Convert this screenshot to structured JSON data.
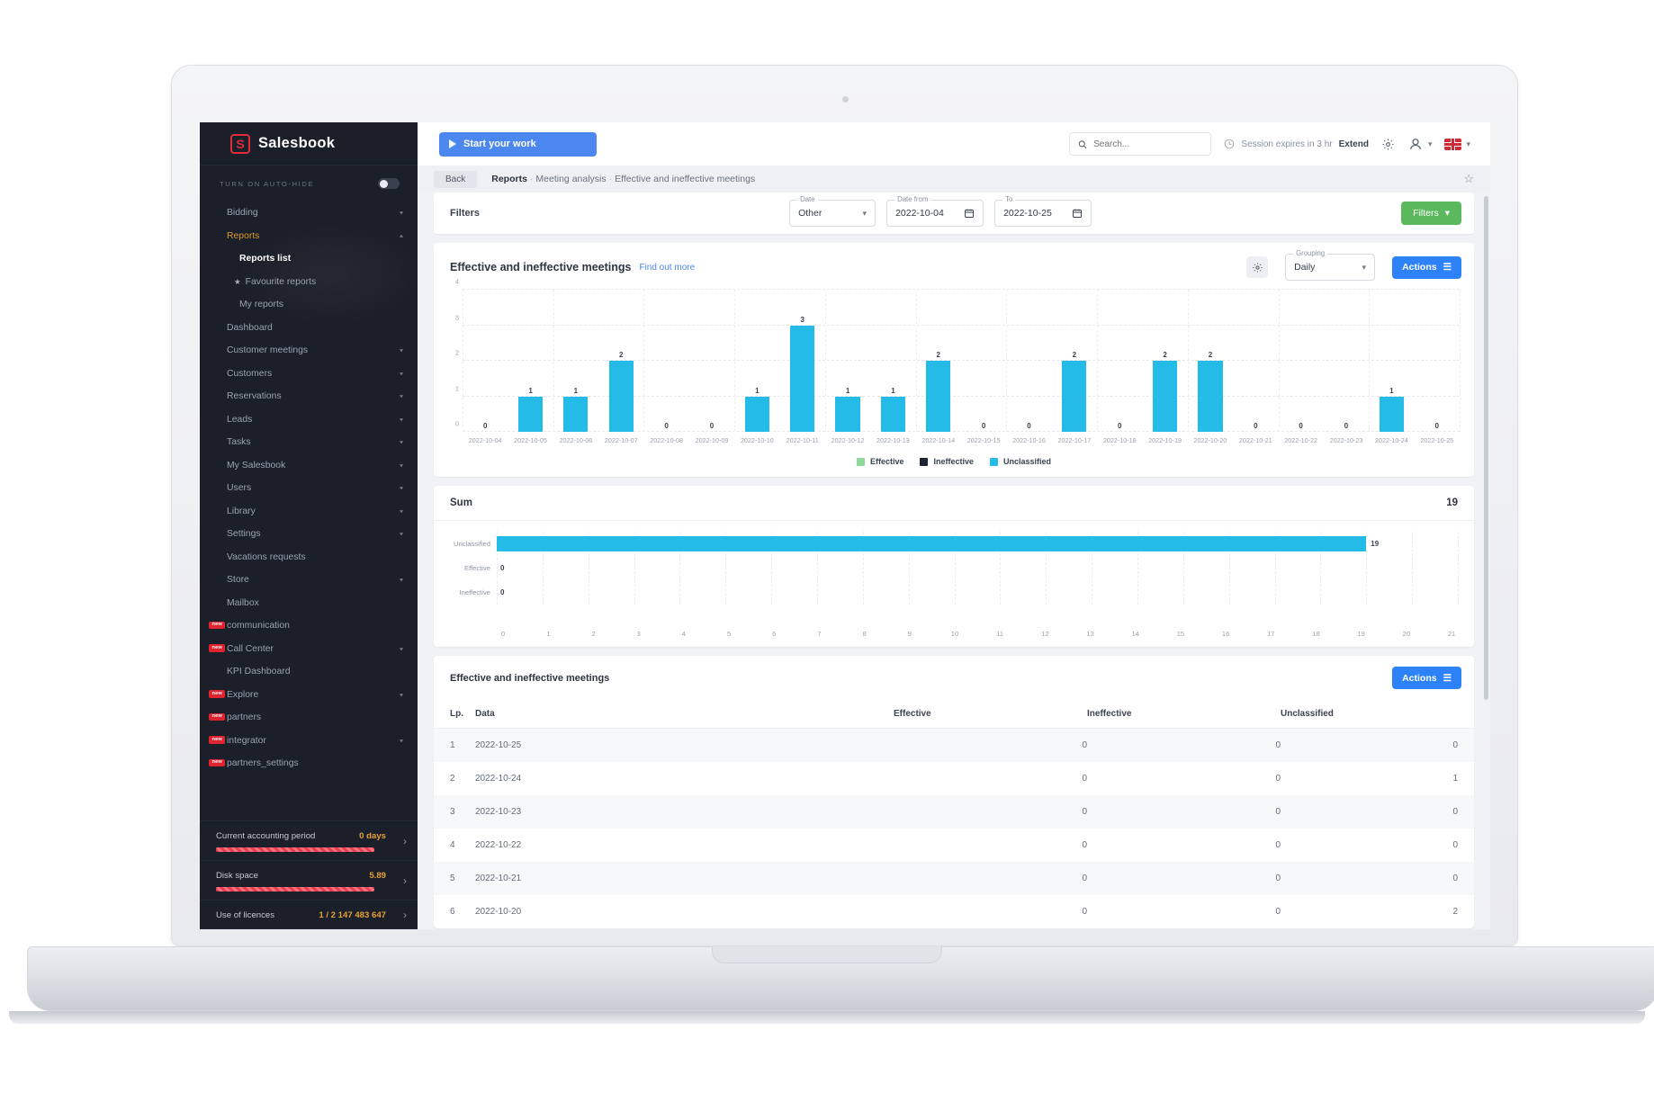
{
  "sidebar": {
    "brand": "Salesbook",
    "brand_mark": "S",
    "autohide_label": "TURN ON AUTO-HIDE",
    "items": [
      {
        "label": "Bidding",
        "chevron": "v",
        "state": "normal"
      },
      {
        "label": "Reports",
        "chevron": "^",
        "state": "active"
      },
      {
        "label": "Reports list",
        "kind": "sub-current"
      },
      {
        "label": "Favourite reports",
        "kind": "sub-fav"
      },
      {
        "label": "My reports",
        "kind": "sub"
      },
      {
        "label": "Dashboard",
        "state": "normal"
      },
      {
        "label": "Customer meetings",
        "chevron": "v"
      },
      {
        "label": "Customers",
        "chevron": "v"
      },
      {
        "label": "Reservations",
        "chevron": "v"
      },
      {
        "label": "Leads",
        "chevron": "v"
      },
      {
        "label": "Tasks",
        "chevron": "v"
      },
      {
        "label": "My Salesbook",
        "chevron": "v"
      },
      {
        "label": "Users",
        "chevron": "v"
      },
      {
        "label": "Library",
        "chevron": "v"
      },
      {
        "label": "Settings",
        "chevron": "v"
      },
      {
        "label": "Vacations requests"
      },
      {
        "label": "Store",
        "chevron": "v"
      },
      {
        "label": "Mailbox"
      },
      {
        "label": "communication",
        "badge": "new"
      },
      {
        "label": "Call Center",
        "badge": "new",
        "chevron": "v"
      },
      {
        "label": "KPI Dashboard"
      },
      {
        "label": "Explore",
        "badge": "new",
        "chevron": "v"
      },
      {
        "label": "partners",
        "badge": "new"
      },
      {
        "label": "integrator",
        "badge": "new",
        "chevron": "v"
      },
      {
        "label": "partners_settings",
        "badge": "new"
      }
    ],
    "cards": [
      {
        "title": "Current accounting period",
        "value": "0 days"
      },
      {
        "title": "Disk space",
        "value": "5.89"
      },
      {
        "title": "Use of licences",
        "value": "1 / 2 147 483 647"
      }
    ]
  },
  "topbar": {
    "start_work": "Start your work",
    "search_placeholder": "Search...",
    "session_text": "Session expires in 3 hr",
    "extend": "Extend"
  },
  "breadcrumb": {
    "back": "Back",
    "root": "Reports",
    "mid": "Meeting analysis",
    "leaf": "Effective and ineffective meetings"
  },
  "filters": {
    "title": "Filters",
    "date_label": "Date",
    "date_value": "Other",
    "date_from_label": "Date from",
    "date_from_value": "2022-10-04",
    "to_label": "To",
    "to_value": "2022-10-25",
    "button": "Filters"
  },
  "chart_card": {
    "title": "Effective and ineffective meetings",
    "find_out_more": "Find out more",
    "grouping_label": "Grouping",
    "grouping_value": "Daily",
    "actions": "Actions"
  },
  "sum_card": {
    "title": "Sum",
    "total": "19"
  },
  "table_card": {
    "title": "Effective and ineffective meetings",
    "actions": "Actions",
    "columns": [
      "Lp.",
      "Data",
      "Effective",
      "Ineffective",
      "Unclassified"
    ],
    "rows": [
      [
        "1",
        "2022-10-25",
        "0",
        "0",
        "0"
      ],
      [
        "2",
        "2022-10-24",
        "0",
        "0",
        "1"
      ],
      [
        "3",
        "2022-10-23",
        "0",
        "0",
        "0"
      ],
      [
        "4",
        "2022-10-22",
        "0",
        "0",
        "0"
      ],
      [
        "5",
        "2022-10-21",
        "0",
        "0",
        "0"
      ],
      [
        "6",
        "2022-10-20",
        "0",
        "0",
        "2"
      ]
    ]
  },
  "colors": {
    "effective": "#8fd99a",
    "ineffective": "#1d2433",
    "unclassified": "#24bbe8",
    "accent_blue": "#2d82f7",
    "accent_green": "#5cb85c",
    "brand_red": "#e02b3b",
    "warn_orange": "#e5a132"
  },
  "chart_data": [
    {
      "type": "bar",
      "title": "Effective and ineffective meetings",
      "xlabel": "",
      "ylabel": "",
      "ylim": [
        0,
        4
      ],
      "yticks": [
        0,
        1,
        2,
        3,
        4
      ],
      "grid": true,
      "legend": [
        "Effective",
        "Ineffective",
        "Unclassified"
      ],
      "legend_position": "bottom-center",
      "categories": [
        "2022-10-04",
        "2022-10-05",
        "2022-10-06",
        "2022-10-07",
        "2022-10-08",
        "2022-10-09",
        "2022-10-10",
        "2022-10-11",
        "2022-10-12",
        "2022-10-13",
        "2022-10-14",
        "2022-10-15",
        "2022-10-16",
        "2022-10-17",
        "2022-10-18",
        "2022-10-19",
        "2022-10-20",
        "2022-10-21",
        "2022-10-22",
        "2022-10-23",
        "2022-10-24",
        "2022-10-25"
      ],
      "series": [
        {
          "name": "Effective",
          "values": [
            0,
            0,
            0,
            0,
            0,
            0,
            0,
            0,
            0,
            0,
            0,
            0,
            0,
            0,
            0,
            0,
            0,
            0,
            0,
            0,
            0,
            0
          ]
        },
        {
          "name": "Ineffective",
          "values": [
            0,
            0,
            0,
            0,
            0,
            0,
            0,
            0,
            0,
            0,
            0,
            0,
            0,
            0,
            0,
            0,
            0,
            0,
            0,
            0,
            0,
            0
          ]
        },
        {
          "name": "Unclassified",
          "values": [
            0,
            1,
            1,
            2,
            0,
            0,
            1,
            3,
            1,
            1,
            2,
            0,
            0,
            2,
            0,
            2,
            2,
            0,
            0,
            0,
            1,
            0
          ]
        }
      ]
    },
    {
      "type": "bar",
      "orientation": "horizontal",
      "title": "Sum",
      "categories": [
        "Unclassified",
        "Effective",
        "Ineffective"
      ],
      "values": [
        19,
        0,
        0
      ],
      "xlim": [
        0,
        21
      ],
      "xticks": [
        0,
        1,
        2,
        3,
        4,
        5,
        6,
        7,
        8,
        9,
        10,
        11,
        12,
        13,
        14,
        15,
        16,
        17,
        18,
        19,
        20,
        21
      ],
      "grid": true
    }
  ]
}
